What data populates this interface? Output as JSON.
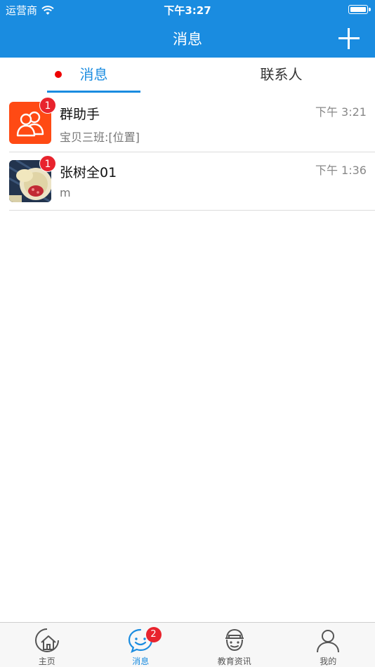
{
  "status_bar": {
    "carrier": "运营商",
    "time": "下午3:27"
  },
  "nav": {
    "title": "消息"
  },
  "tabs": {
    "messages": "消息",
    "contacts": "联系人"
  },
  "conversations": [
    {
      "name": "群助手",
      "preview": "宝贝三班:[位置]",
      "time": "下午 3:21",
      "unread": "1"
    },
    {
      "name": "张树全01",
      "preview": "m",
      "time": "下午 1:36",
      "unread": "1"
    }
  ],
  "tabbar": {
    "items": [
      {
        "label": "主页"
      },
      {
        "label": "消息",
        "badge": "2"
      },
      {
        "label": "教育资讯"
      },
      {
        "label": "我的"
      }
    ]
  },
  "colors": {
    "primary": "#1a8ce0",
    "badge": "#e8232d",
    "group_avatar": "#ff4a14"
  }
}
